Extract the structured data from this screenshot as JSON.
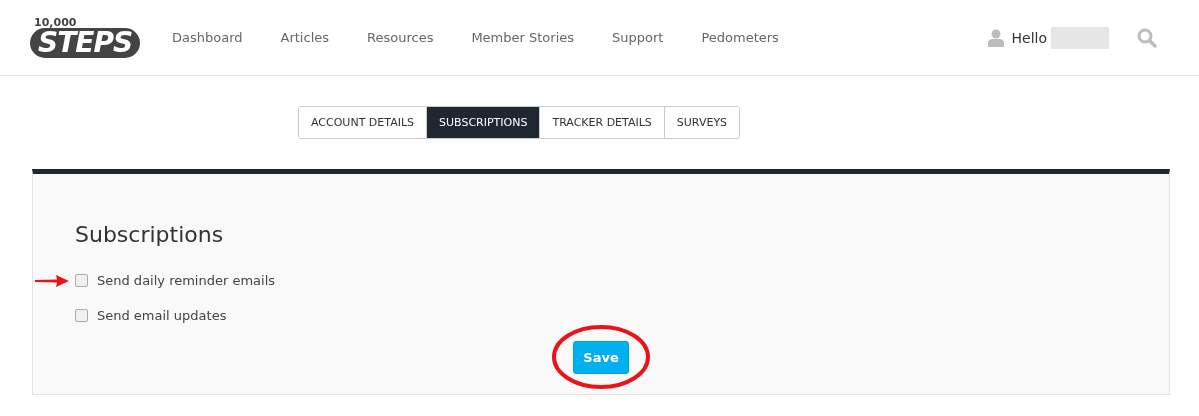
{
  "logo": {
    "number": "10,000",
    "word": "STEPS"
  },
  "nav": [
    {
      "label": "Dashboard"
    },
    {
      "label": "Articles"
    },
    {
      "label": "Resources"
    },
    {
      "label": "Member Stories"
    },
    {
      "label": "Support"
    },
    {
      "label": "Pedometers"
    }
  ],
  "user": {
    "greeting": "Hello"
  },
  "tabs": [
    {
      "label": "ACCOUNT DETAILS",
      "selected": false
    },
    {
      "label": "SUBSCRIPTIONS",
      "selected": true
    },
    {
      "label": "TRACKER DETAILS",
      "selected": false
    },
    {
      "label": "SURVEYS",
      "selected": false
    }
  ],
  "panel": {
    "title": "Subscriptions",
    "options": [
      {
        "label": "Send daily reminder emails",
        "checked": false,
        "annotated": true
      },
      {
        "label": "Send email updates",
        "checked": false,
        "annotated": false
      }
    ],
    "save_button": {
      "label": "Save",
      "annotated": true
    }
  }
}
